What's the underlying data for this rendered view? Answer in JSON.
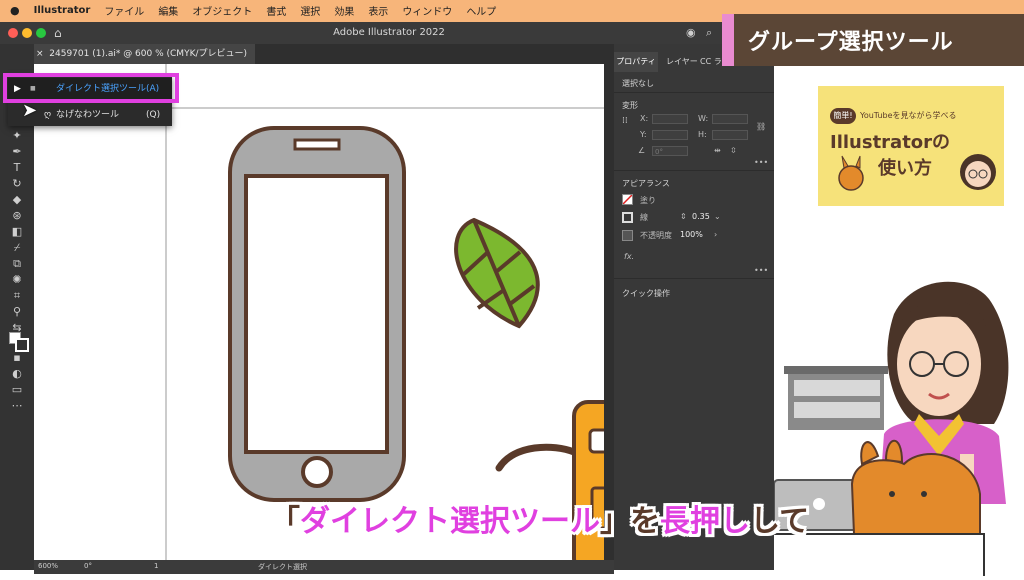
{
  "menubar": {
    "items": [
      "Illustrator",
      "ファイル",
      "編集",
      "オブジェクト",
      "書式",
      "選択",
      "効果",
      "表示",
      "ウィンドウ",
      "ヘルプ"
    ]
  },
  "window": {
    "title": "Adobe Illustrator 2022"
  },
  "document_tab": {
    "label": "2459701 (1).ai* @ 600 % (CMYK/プレビュー)"
  },
  "flyout": {
    "items": [
      {
        "label": "ダイレクト選択ツール",
        "shortcut": "(A)"
      },
      {
        "label": "なげなわツール",
        "shortcut": "(Q)"
      }
    ]
  },
  "panel": {
    "tabs": [
      "プロパティ",
      "レイヤー",
      "CC ライ"
    ],
    "selection": "選択なし",
    "transform": {
      "title": "変形",
      "x_label": "X:",
      "y_label": "Y:",
      "w_label": "W:",
      "h_label": "H:",
      "angle_value": "0°"
    },
    "appearance": {
      "title": "アピアランス",
      "fill_label": "塗り",
      "stroke_label": "線",
      "stroke_width": "0.35",
      "opacity_label": "不透明度",
      "opacity_value": "100%",
      "fx": "fx."
    },
    "quick_actions": "クイック操作"
  },
  "statusbar": {
    "zoom": "600%",
    "rotation": "0°",
    "artboard": "1",
    "tool": "ダイレクト選択"
  },
  "banner": {
    "title": "グループ選択ツール"
  },
  "logo": {
    "badge": "簡単!",
    "line1": "YouTubeを見ながら学べる",
    "line2": "Illustratorの",
    "line3": "使い方"
  },
  "caption": {
    "open": "「",
    "highlight": "ダイレクト選択ツール",
    "close": "」を",
    "emphasis": "長押し",
    "rest": "して"
  },
  "colors": {
    "accent_pink": "#e040e0",
    "menubar": "#f7b57a",
    "banner": "#5b4636",
    "leaf": "#7cb82f",
    "phone_body": "#a9a9a9",
    "outline": "#5a3a2a"
  }
}
